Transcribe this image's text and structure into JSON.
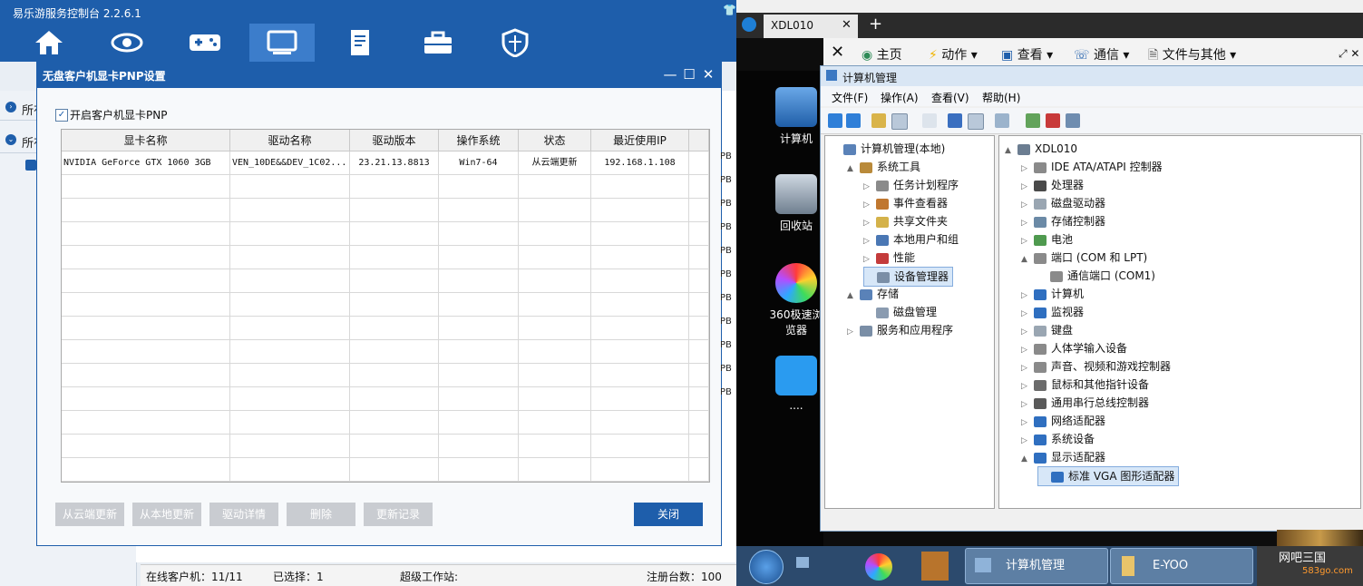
{
  "app": {
    "title": "易乐游服务控制台 2.2.6.1",
    "nav_icons": [
      "home-icon",
      "eye-icon",
      "gamepad-icon",
      "monitor-icon",
      "document-icon",
      "toolbox-icon",
      "shield-icon"
    ],
    "active_nav": "monitor-icon",
    "side_items": [
      "所有",
      "所有"
    ],
    "pb_rows": [
      "PB",
      "PB",
      "PB",
      "PB",
      "PB",
      "PB",
      "PB",
      "PB",
      "PB",
      "PB",
      "PB"
    ],
    "status": {
      "online": "在线客户机：11/11",
      "selected": "已选择：1",
      "super_ws": "超级工作站:",
      "registered": "注册台数：100"
    }
  },
  "dialog": {
    "title": "无盘客户机显卡PNP设置",
    "checkbox_label": "开启客户机显卡PNP",
    "checkbox_checked": true,
    "columns": [
      "显卡名称",
      "驱动名称",
      "驱动版本",
      "操作系统",
      "状态",
      "最近使用IP"
    ],
    "rows": [
      [
        "NVIDIA GeForce GTX 1060 3GB",
        "VEN_10DE&&DEV_1C02...",
        "23.21.13.8813",
        "Win7-64",
        "从云端更新",
        "192.168.1.108"
      ]
    ],
    "buttons": [
      "从云端更新",
      "从本地更新",
      "驱动详情",
      "删除",
      "更新记录"
    ],
    "close_label": "关闭"
  },
  "remote": {
    "tab_label": "XDL010",
    "toolbar": [
      "主页",
      "动作",
      "查看",
      "通信",
      "文件与其他"
    ],
    "desktop_icons": [
      "计算机",
      "回收站",
      "360极速浏览器",
      "...."
    ],
    "mmc": {
      "title": "计算机管理",
      "menu": [
        "文件(F)",
        "操作(A)",
        "查看(V)",
        "帮助(H)"
      ],
      "left_tree": [
        {
          "label": "计算机管理(本地)",
          "level": 0,
          "exp": ""
        },
        {
          "label": "系统工具",
          "level": 1,
          "exp": "▲"
        },
        {
          "label": "任务计划程序",
          "level": 2,
          "exp": "▷"
        },
        {
          "label": "事件查看器",
          "level": 2,
          "exp": "▷"
        },
        {
          "label": "共享文件夹",
          "level": 2,
          "exp": "▷"
        },
        {
          "label": "本地用户和组",
          "level": 2,
          "exp": "▷"
        },
        {
          "label": "性能",
          "level": 2,
          "exp": "▷"
        },
        {
          "label": "设备管理器",
          "level": 2,
          "exp": "",
          "selected": true
        },
        {
          "label": "存储",
          "level": 1,
          "exp": "▲"
        },
        {
          "label": "磁盘管理",
          "level": 2,
          "exp": ""
        },
        {
          "label": "服务和应用程序",
          "level": 1,
          "exp": "▷"
        }
      ],
      "right_tree": [
        {
          "label": "XDL010",
          "level": 0,
          "exp": "▲"
        },
        {
          "label": "IDE ATA/ATAPI 控制器",
          "level": 1,
          "exp": "▷"
        },
        {
          "label": "处理器",
          "level": 1,
          "exp": "▷"
        },
        {
          "label": "磁盘驱动器",
          "level": 1,
          "exp": "▷"
        },
        {
          "label": "存储控制器",
          "level": 1,
          "exp": "▷"
        },
        {
          "label": "电池",
          "level": 1,
          "exp": "▷"
        },
        {
          "label": "端口 (COM 和 LPT)",
          "level": 1,
          "exp": "▲"
        },
        {
          "label": "通信端口 (COM1)",
          "level": 2,
          "exp": ""
        },
        {
          "label": "计算机",
          "level": 1,
          "exp": "▷"
        },
        {
          "label": "监视器",
          "level": 1,
          "exp": "▷"
        },
        {
          "label": "键盘",
          "level": 1,
          "exp": "▷"
        },
        {
          "label": "人体学输入设备",
          "level": 1,
          "exp": "▷"
        },
        {
          "label": "声音、视频和游戏控制器",
          "level": 1,
          "exp": "▷"
        },
        {
          "label": "鼠标和其他指针设备",
          "level": 1,
          "exp": "▷"
        },
        {
          "label": "通用串行总线控制器",
          "level": 1,
          "exp": "▷"
        },
        {
          "label": "网络适配器",
          "level": 1,
          "exp": "▷"
        },
        {
          "label": "系统设备",
          "level": 1,
          "exp": "▷"
        },
        {
          "label": "显示适配器",
          "level": 1,
          "exp": "▲"
        },
        {
          "label": "标准 VGA 图形适配器",
          "level": 2,
          "exp": "",
          "selected": true
        }
      ]
    },
    "taskbar": {
      "items": [
        "计算机管理",
        "E-YOO"
      ],
      "watermark": "网吧三国",
      "watermark_sub": "583go.com"
    }
  }
}
